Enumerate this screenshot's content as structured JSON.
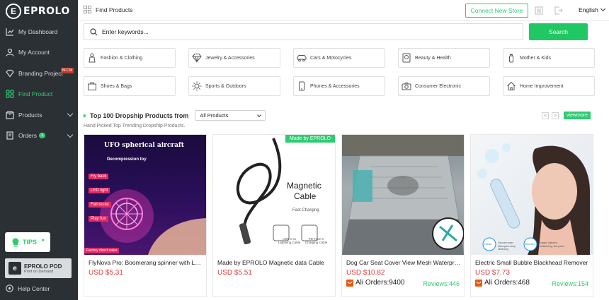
{
  "app": {
    "logo": "EPROLO",
    "logo_mark": "E"
  },
  "sidebar": {
    "items": [
      {
        "label": "My Dashboard",
        "icon": "dashboard-icon"
      },
      {
        "label": "My Account",
        "icon": "user-icon"
      },
      {
        "label": "Branding Project",
        "icon": "diamond-icon",
        "badge": "BFCM"
      },
      {
        "label": "Find Product",
        "icon": "grid-icon",
        "active": true
      },
      {
        "label": "Products",
        "icon": "box-icon"
      },
      {
        "label": "Orders",
        "icon": "orders-icon",
        "count": "1"
      }
    ],
    "tips": "TIPS",
    "pod": {
      "title": "EPROLO POD",
      "subtitle": "Print on Demand"
    },
    "help": "Help Center"
  },
  "header": {
    "breadcrumb": "Find Products",
    "connect_store": "Connect New Store",
    "language": "English"
  },
  "search": {
    "placeholder": "Enter keywords...",
    "button": "Search"
  },
  "categories": [
    "Fashion & Clothing",
    "Jewelry & Accessories",
    "Cars & Motocycles",
    "Beauty & Health",
    "Mother & Kids",
    "Shoes & Bags",
    "Sports & Outdoors",
    "Phones & Accessories",
    "Consumer Electronic",
    "Home Improvement"
  ],
  "section": {
    "title": "Top 100 Dropship Products from",
    "filter": "All Products",
    "subtitle": "Hand Picked Top Trending Dropship Products.",
    "prev": "<",
    "next": ">",
    "viewmore": "viewmore"
  },
  "products": [
    {
      "title": "FlyNova Pro: Boomerang spinner with LED",
      "price": "USD $5.31",
      "image_text": {
        "headline": "UFO spherical aircraft",
        "sub": "Decompression toy",
        "features": [
          "Fly back",
          "LED light",
          "Fall resist",
          "Play fun"
        ],
        "footer": "Factory direct sales"
      }
    },
    {
      "title": "Made by EPROLO Magnetic data Cable",
      "price": "USD $5.51",
      "badge": "Made by EPROLO",
      "image_text": {
        "headline1": "Magnetic",
        "headline2": "Cable",
        "sub": "Fast Charging",
        "left_label1": "USB C to",
        "left_label2": "Lightning Cable",
        "right_label1": "PD Type C",
        "right_label2": "Charging Cable"
      }
    },
    {
      "title": "Dog Car Seat Cover View Mesh Waterproof",
      "price": "USD $10.82",
      "orders": "Ali Orders:9400",
      "reviews": "Reviews:446"
    },
    {
      "title": "Electric Small Bubble Blackhead Remover",
      "price": "USD $7.73",
      "orders": "Ali Orders:468",
      "reviews": "Reviews:154",
      "image_text": {
        "c1": "Clean",
        "c2": "Nourish",
        "t1": "Vacuum water absorption deep cleansing",
        "t2": "Oxygen injection, moisturizing, fine pores"
      }
    }
  ],
  "colors": {
    "accent": "#2ecc71",
    "sidebar": "#2b3035",
    "price": "#e03a3a"
  }
}
